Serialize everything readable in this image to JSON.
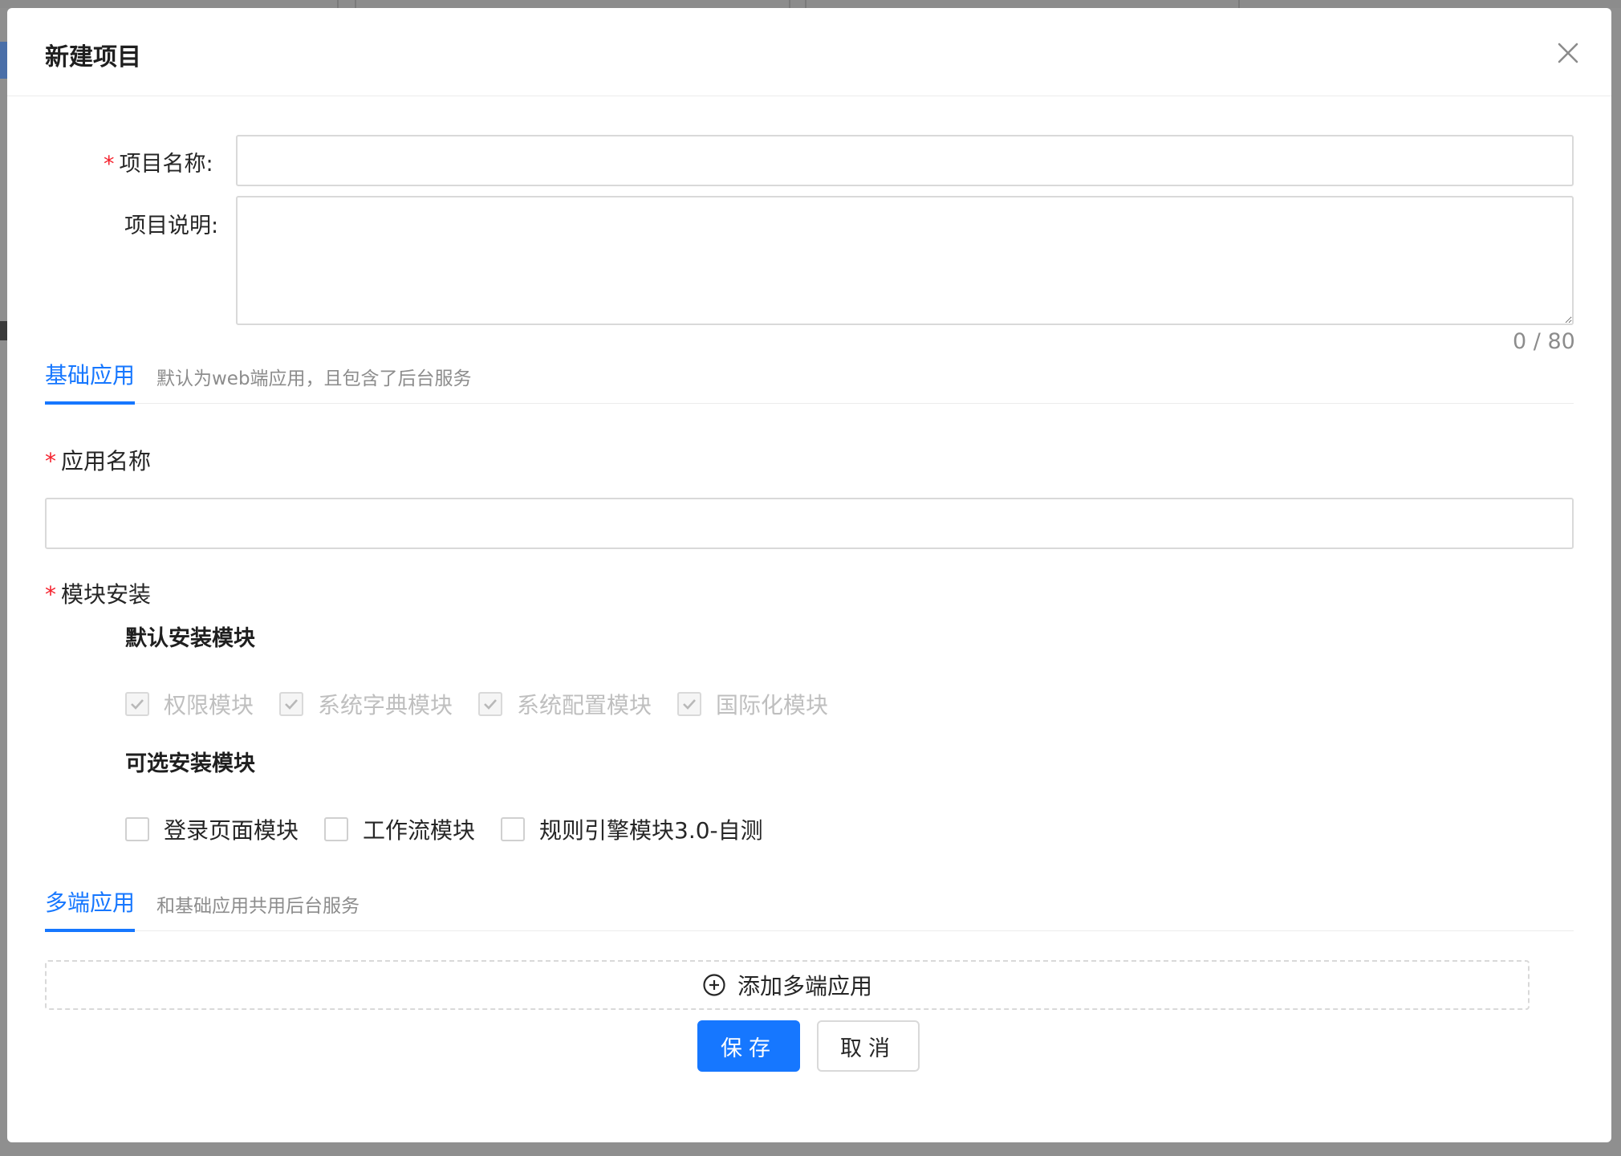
{
  "modal": {
    "title": "新建项目"
  },
  "form": {
    "project_name_label": "项目名称:",
    "project_name_value": "",
    "project_desc_label": "项目说明:",
    "project_desc_value": "",
    "desc_counter": "0 / 80",
    "required_mark": "*"
  },
  "base_app": {
    "tab_label": "基础应用",
    "tab_desc": "默认为web端应用，且包含了后台服务",
    "app_name_label": "应用名称",
    "app_name_value": "",
    "module_label": "模块安装",
    "default_group_title": "默认安装模块",
    "default_modules": [
      {
        "label": "权限模块",
        "checked": true,
        "disabled": true
      },
      {
        "label": "系统字典模块",
        "checked": true,
        "disabled": true
      },
      {
        "label": "系统配置模块",
        "checked": true,
        "disabled": true
      },
      {
        "label": "国际化模块",
        "checked": true,
        "disabled": true
      }
    ],
    "optional_group_title": "可选安装模块",
    "optional_modules": [
      {
        "label": "登录页面模块",
        "checked": false
      },
      {
        "label": "工作流模块",
        "checked": false
      },
      {
        "label": "规则引擎模块3.0-自测",
        "checked": false
      }
    ]
  },
  "multi_app": {
    "tab_label": "多端应用",
    "tab_desc": "和基础应用共用后台服务",
    "add_label": "添加多端应用"
  },
  "footer": {
    "save_label": "保存",
    "cancel_label": "取消"
  },
  "colors": {
    "primary": "#1677ff",
    "required": "#f5222d",
    "overlay": "#8f8f8f"
  },
  "icons": {
    "close": "close-icon",
    "add": "plus-circle-icon",
    "check": "check-icon"
  }
}
